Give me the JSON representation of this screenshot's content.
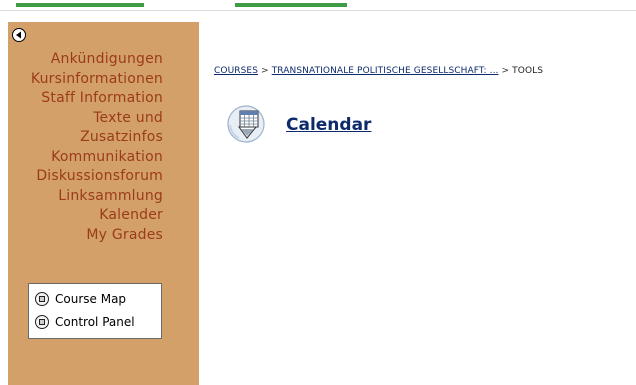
{
  "sidebar": {
    "items": [
      {
        "label": "Ankündigungen"
      },
      {
        "label": "Kursinformationen"
      },
      {
        "label": "Staff Information"
      },
      {
        "label": "Texte und"
      },
      {
        "label": "Zusatzinfos"
      },
      {
        "label": "Kommunikation"
      },
      {
        "label": "Diskussionsforum"
      },
      {
        "label": "Linksammlung"
      },
      {
        "label": "Kalender"
      },
      {
        "label": "My Grades"
      }
    ],
    "tools": {
      "course_map": "Course Map",
      "control_panel": "Control Panel"
    }
  },
  "breadcrumb": {
    "root": "COURSES",
    "course": "TRANSNATIONALE POLITISCHE GESELLSCHAFT: ...",
    "current": "TOOLS",
    "separator": ">"
  },
  "content": {
    "calendar_label": "Calendar"
  },
  "colors": {
    "sidebar_bg": "#d3a06a",
    "menu_text": "#9b3b18",
    "link": "#0d2a6b",
    "tab_green": "#3f9b45"
  }
}
